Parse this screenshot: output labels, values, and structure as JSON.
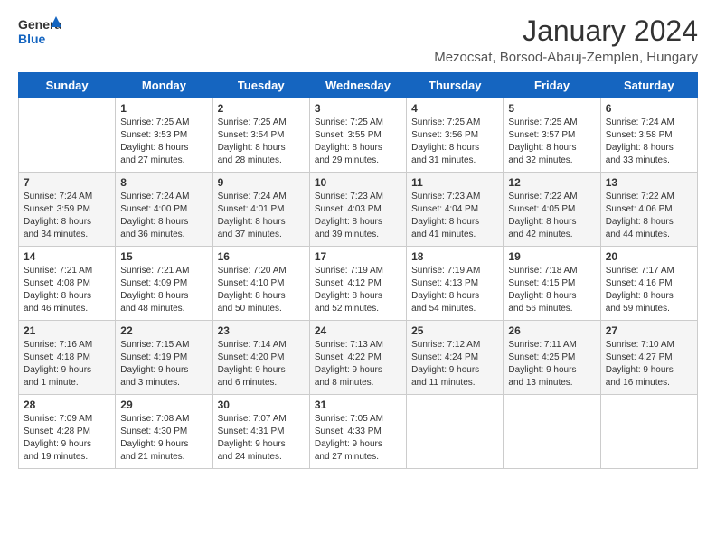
{
  "header": {
    "logo_general": "General",
    "logo_blue": "Blue",
    "month_title": "January 2024",
    "location": "Mezocsat, Borsod-Abauj-Zemplen, Hungary"
  },
  "days_of_week": [
    "Sunday",
    "Monday",
    "Tuesday",
    "Wednesday",
    "Thursday",
    "Friday",
    "Saturday"
  ],
  "weeks": [
    [
      {
        "day": "",
        "info": ""
      },
      {
        "day": "1",
        "info": "Sunrise: 7:25 AM\nSunset: 3:53 PM\nDaylight: 8 hours\nand 27 minutes."
      },
      {
        "day": "2",
        "info": "Sunrise: 7:25 AM\nSunset: 3:54 PM\nDaylight: 8 hours\nand 28 minutes."
      },
      {
        "day": "3",
        "info": "Sunrise: 7:25 AM\nSunset: 3:55 PM\nDaylight: 8 hours\nand 29 minutes."
      },
      {
        "day": "4",
        "info": "Sunrise: 7:25 AM\nSunset: 3:56 PM\nDaylight: 8 hours\nand 31 minutes."
      },
      {
        "day": "5",
        "info": "Sunrise: 7:25 AM\nSunset: 3:57 PM\nDaylight: 8 hours\nand 32 minutes."
      },
      {
        "day": "6",
        "info": "Sunrise: 7:24 AM\nSunset: 3:58 PM\nDaylight: 8 hours\nand 33 minutes."
      }
    ],
    [
      {
        "day": "7",
        "info": "Sunrise: 7:24 AM\nSunset: 3:59 PM\nDaylight: 8 hours\nand 34 minutes."
      },
      {
        "day": "8",
        "info": "Sunrise: 7:24 AM\nSunset: 4:00 PM\nDaylight: 8 hours\nand 36 minutes."
      },
      {
        "day": "9",
        "info": "Sunrise: 7:24 AM\nSunset: 4:01 PM\nDaylight: 8 hours\nand 37 minutes."
      },
      {
        "day": "10",
        "info": "Sunrise: 7:23 AM\nSunset: 4:03 PM\nDaylight: 8 hours\nand 39 minutes."
      },
      {
        "day": "11",
        "info": "Sunrise: 7:23 AM\nSunset: 4:04 PM\nDaylight: 8 hours\nand 41 minutes."
      },
      {
        "day": "12",
        "info": "Sunrise: 7:22 AM\nSunset: 4:05 PM\nDaylight: 8 hours\nand 42 minutes."
      },
      {
        "day": "13",
        "info": "Sunrise: 7:22 AM\nSunset: 4:06 PM\nDaylight: 8 hours\nand 44 minutes."
      }
    ],
    [
      {
        "day": "14",
        "info": "Sunrise: 7:21 AM\nSunset: 4:08 PM\nDaylight: 8 hours\nand 46 minutes."
      },
      {
        "day": "15",
        "info": "Sunrise: 7:21 AM\nSunset: 4:09 PM\nDaylight: 8 hours\nand 48 minutes."
      },
      {
        "day": "16",
        "info": "Sunrise: 7:20 AM\nSunset: 4:10 PM\nDaylight: 8 hours\nand 50 minutes."
      },
      {
        "day": "17",
        "info": "Sunrise: 7:19 AM\nSunset: 4:12 PM\nDaylight: 8 hours\nand 52 minutes."
      },
      {
        "day": "18",
        "info": "Sunrise: 7:19 AM\nSunset: 4:13 PM\nDaylight: 8 hours\nand 54 minutes."
      },
      {
        "day": "19",
        "info": "Sunrise: 7:18 AM\nSunset: 4:15 PM\nDaylight: 8 hours\nand 56 minutes."
      },
      {
        "day": "20",
        "info": "Sunrise: 7:17 AM\nSunset: 4:16 PM\nDaylight: 8 hours\nand 59 minutes."
      }
    ],
    [
      {
        "day": "21",
        "info": "Sunrise: 7:16 AM\nSunset: 4:18 PM\nDaylight: 9 hours\nand 1 minute."
      },
      {
        "day": "22",
        "info": "Sunrise: 7:15 AM\nSunset: 4:19 PM\nDaylight: 9 hours\nand 3 minutes."
      },
      {
        "day": "23",
        "info": "Sunrise: 7:14 AM\nSunset: 4:20 PM\nDaylight: 9 hours\nand 6 minutes."
      },
      {
        "day": "24",
        "info": "Sunrise: 7:13 AM\nSunset: 4:22 PM\nDaylight: 9 hours\nand 8 minutes."
      },
      {
        "day": "25",
        "info": "Sunrise: 7:12 AM\nSunset: 4:24 PM\nDaylight: 9 hours\nand 11 minutes."
      },
      {
        "day": "26",
        "info": "Sunrise: 7:11 AM\nSunset: 4:25 PM\nDaylight: 9 hours\nand 13 minutes."
      },
      {
        "day": "27",
        "info": "Sunrise: 7:10 AM\nSunset: 4:27 PM\nDaylight: 9 hours\nand 16 minutes."
      }
    ],
    [
      {
        "day": "28",
        "info": "Sunrise: 7:09 AM\nSunset: 4:28 PM\nDaylight: 9 hours\nand 19 minutes."
      },
      {
        "day": "29",
        "info": "Sunrise: 7:08 AM\nSunset: 4:30 PM\nDaylight: 9 hours\nand 21 minutes."
      },
      {
        "day": "30",
        "info": "Sunrise: 7:07 AM\nSunset: 4:31 PM\nDaylight: 9 hours\nand 24 minutes."
      },
      {
        "day": "31",
        "info": "Sunrise: 7:05 AM\nSunset: 4:33 PM\nDaylight: 9 hours\nand 27 minutes."
      },
      {
        "day": "",
        "info": ""
      },
      {
        "day": "",
        "info": ""
      },
      {
        "day": "",
        "info": ""
      }
    ]
  ]
}
